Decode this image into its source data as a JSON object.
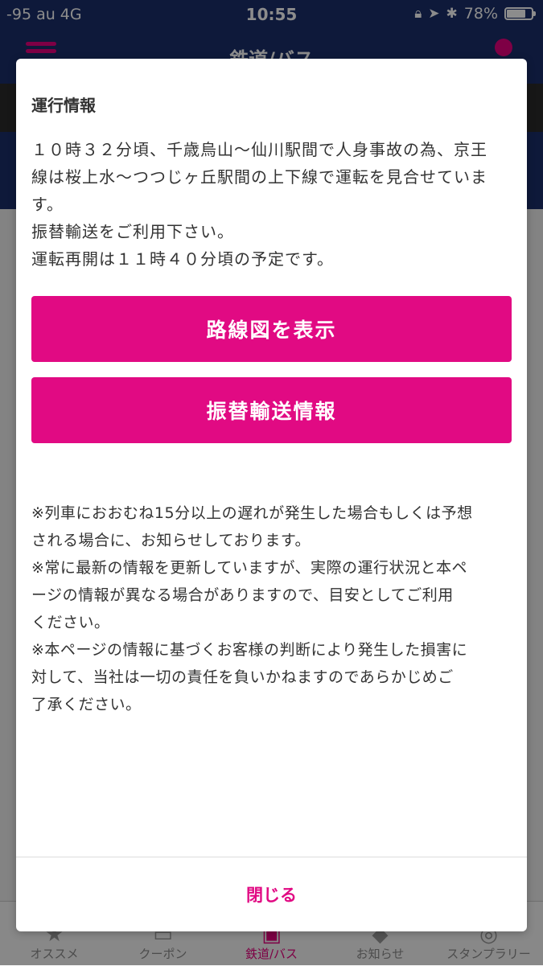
{
  "status_bar": {
    "signal": "-95  au    4G",
    "time": "10:55",
    "battery": "78%",
    "battery_level": 0.78,
    "icons": [
      "rotation-lock-icon",
      "location-arrow-icon",
      "bluetooth-icon",
      "battery-icon"
    ]
  },
  "nav": {
    "title": "鉄道/バス",
    "menu_icon": "hamburger-icon"
  },
  "tabs": [
    {
      "label": "オススメ",
      "icon": "recommend-icon"
    },
    {
      "label": "クーポン",
      "icon": "coupon-icon"
    },
    {
      "label": "鉄道/バス",
      "icon": "train-icon"
    },
    {
      "label": "お知らせ",
      "icon": "notice-icon"
    },
    {
      "label": "スタンプラリー",
      "icon": "stamp-icon"
    }
  ],
  "modal": {
    "title": "運行情報",
    "message_lines": [
      "１０時３２分頃、千歳烏山〜仙川駅間で人身事故の為、京王",
      "線は桜上水〜つつじヶ丘駅間の上下線で運転を見合せていま",
      "す。",
      "振替輸送をご利用下さい。",
      "運転再開は１１時４０分頃の予定です。"
    ],
    "route_button_label": "路線図を表示",
    "transfer_button_label": "振替輸送情報",
    "notes": [
      "※列車におおむね15分以上の遅れが発生した場合もしくは予想",
      "される場合に、お知らせしております。",
      "※常に最新の情報を更新していますが、実際の運行状況と本ペ",
      "ージの情報が異なる場合がありますので、目安としてご利用",
      "ください。",
      "※本ページの情報に基づくお客様の判断により発生した損害に",
      "対して、当社は一切の責任を負いかねますのであらかじめご",
      "了承ください。"
    ],
    "close_label": "閉じる"
  },
  "colors": {
    "accent": "#e10a83",
    "nav_background": "#1b2f6b"
  }
}
